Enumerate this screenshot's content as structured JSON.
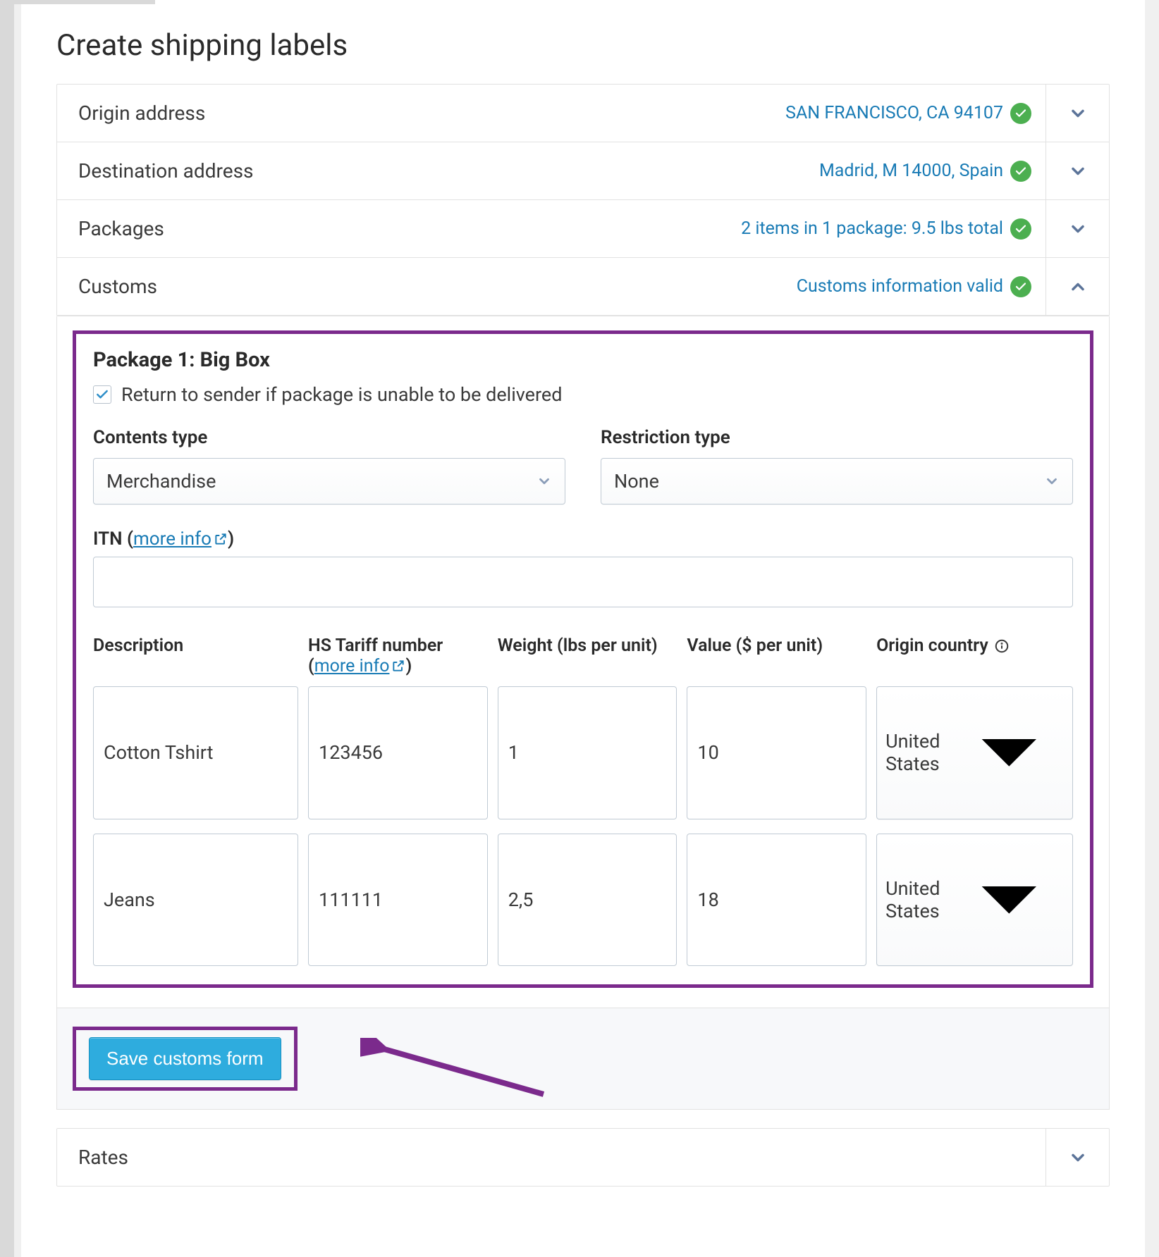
{
  "page_title": "Create shipping labels",
  "sections": {
    "origin": {
      "label": "Origin address",
      "summary": "SAN FRANCISCO, CA  94107"
    },
    "destination": {
      "label": "Destination address",
      "summary": "Madrid, M  14000, Spain"
    },
    "packages": {
      "label": "Packages",
      "summary": "2 items in 1 package: 9.5 lbs total"
    },
    "customs": {
      "label": "Customs",
      "summary": "Customs information valid"
    },
    "rates": {
      "label": "Rates"
    }
  },
  "customs_form": {
    "package_title": "Package 1: Big Box",
    "return_to_sender_label": "Return to sender if package is unable to be delivered",
    "return_to_sender_checked": true,
    "contents_type_label": "Contents type",
    "contents_type_value": "Merchandise",
    "restriction_type_label": "Restriction type",
    "restriction_type_value": "None",
    "itn_label_prefix": "ITN (",
    "itn_more_info": "more info",
    "itn_label_suffix": ")",
    "itn_value": "",
    "columns": {
      "description": "Description",
      "hs_tariff_prefix": "HS Tariff number (",
      "hs_tariff_link": "more info",
      "hs_tariff_suffix": ")",
      "weight": "Weight (lbs per unit)",
      "value": "Value ($ per unit)",
      "origin_country": "Origin country"
    },
    "items": [
      {
        "description": "Cotton Tshirt",
        "hs_tariff": "123456",
        "weight": "1",
        "value": "10",
        "origin_country": "United States"
      },
      {
        "description": "Jeans",
        "hs_tariff": "111111",
        "weight": "2,5",
        "value": "18",
        "origin_country": "United States"
      }
    ],
    "save_button": "Save customs form"
  },
  "colors": {
    "accent_link": "#197bb5",
    "highlight_border": "#7b2a8c",
    "success": "#4caf50",
    "primary_button": "#2eacde"
  }
}
